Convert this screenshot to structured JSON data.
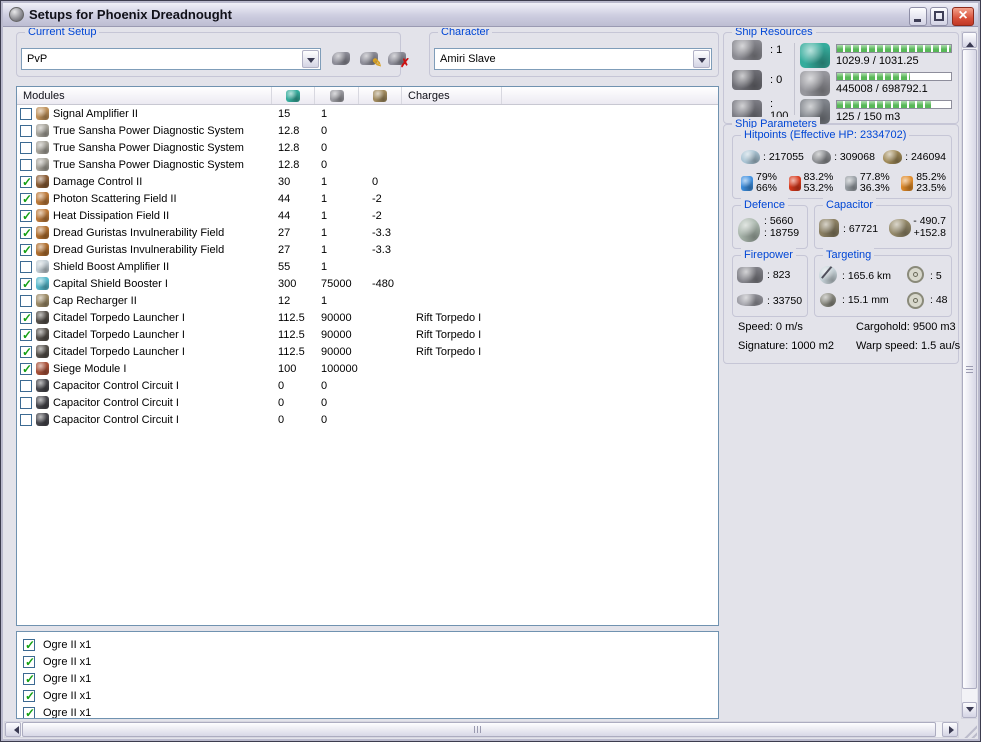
{
  "window": {
    "title": "Setups for Phoenix Dreadnought"
  },
  "setup_group": {
    "label": "Current Setup",
    "value": "PvP"
  },
  "character_group": {
    "label": "Character",
    "value": "Amiri Slave"
  },
  "modules_table": {
    "header": {
      "name": "Modules",
      "charges": "Charges"
    },
    "rows": [
      {
        "checked": false,
        "icon": "signal-amplifier",
        "color": "#bf915a",
        "name": "Signal Amplifier II",
        "cpu": "15",
        "pg": "1",
        "cap": "",
        "charge": ""
      },
      {
        "checked": false,
        "icon": "power-diagnostic",
        "color": "#a6a39a",
        "name": "True Sansha Power Diagnostic System",
        "cpu": "12.8",
        "pg": "0",
        "cap": "",
        "charge": ""
      },
      {
        "checked": false,
        "icon": "power-diagnostic",
        "color": "#a6a39a",
        "name": "True Sansha Power Diagnostic System",
        "cpu": "12.8",
        "pg": "0",
        "cap": "",
        "charge": ""
      },
      {
        "checked": false,
        "icon": "power-diagnostic",
        "color": "#a6a39a",
        "name": "True Sansha Power Diagnostic System",
        "cpu": "12.8",
        "pg": "0",
        "cap": "",
        "charge": ""
      },
      {
        "checked": true,
        "icon": "damage-control",
        "color": "#8a5c34",
        "name": "Damage Control II",
        "cpu": "30",
        "pg": "1",
        "cap": "0",
        "charge": ""
      },
      {
        "checked": true,
        "icon": "shield-hardener",
        "color": "#bd7a3a",
        "name": "Photon Scattering Field II",
        "cpu": "44",
        "pg": "1",
        "cap": "-2",
        "charge": ""
      },
      {
        "checked": true,
        "icon": "shield-hardener",
        "color": "#bd7a3a",
        "name": "Heat Dissipation Field II",
        "cpu": "44",
        "pg": "1",
        "cap": "-2",
        "charge": ""
      },
      {
        "checked": true,
        "icon": "shield-hardener",
        "color": "#b06f2f",
        "name": "Dread Guristas Invulnerability Field",
        "cpu": "27",
        "pg": "1",
        "cap": "-3.3",
        "charge": ""
      },
      {
        "checked": true,
        "icon": "shield-hardener",
        "color": "#b06f2f",
        "name": "Dread Guristas Invulnerability Field",
        "cpu": "27",
        "pg": "1",
        "cap": "-3.3",
        "charge": ""
      },
      {
        "checked": false,
        "icon": "shield-boost-amplifier",
        "color": "#c2cdd4",
        "name": "Shield Boost Amplifier II",
        "cpu": "55",
        "pg": "1",
        "cap": "",
        "charge": ""
      },
      {
        "checked": true,
        "icon": "shield-booster",
        "color": "#56b9cc",
        "name": "Capital Shield Booster I",
        "cpu": "300",
        "pg": "75000",
        "cap": "-480",
        "charge": ""
      },
      {
        "checked": false,
        "icon": "cap-recharger",
        "color": "#9c8a66",
        "name": "Cap Recharger II",
        "cpu": "12",
        "pg": "1",
        "cap": "",
        "charge": ""
      },
      {
        "checked": true,
        "icon": "torpedo-launcher",
        "color": "#55504a",
        "name": "Citadel Torpedo Launcher I",
        "cpu": "112.5",
        "pg": "90000",
        "cap": "",
        "charge": "Rift Torpedo I"
      },
      {
        "checked": true,
        "icon": "torpedo-launcher",
        "color": "#55504a",
        "name": "Citadel Torpedo Launcher I",
        "cpu": "112.5",
        "pg": "90000",
        "cap": "",
        "charge": "Rift Torpedo I"
      },
      {
        "checked": true,
        "icon": "torpedo-launcher",
        "color": "#55504a",
        "name": "Citadel Torpedo Launcher I",
        "cpu": "112.5",
        "pg": "90000",
        "cap": "",
        "charge": "Rift Torpedo I"
      },
      {
        "checked": true,
        "icon": "siege-module",
        "color": "#a85038",
        "name": "Siege Module I",
        "cpu": "100",
        "pg": "100000",
        "cap": "",
        "charge": ""
      },
      {
        "checked": false,
        "icon": "cap-control-circuit",
        "color": "#46464c",
        "name": "Capacitor Control Circuit I",
        "cpu": "0",
        "pg": "0",
        "cap": "",
        "charge": ""
      },
      {
        "checked": false,
        "icon": "cap-control-circuit",
        "color": "#46464c",
        "name": "Capacitor Control Circuit I",
        "cpu": "0",
        "pg": "0",
        "cap": "",
        "charge": ""
      },
      {
        "checked": false,
        "icon": "cap-control-circuit",
        "color": "#46464c",
        "name": "Capacitor Control Circuit I",
        "cpu": "0",
        "pg": "0",
        "cap": "",
        "charge": ""
      }
    ]
  },
  "drones_list": {
    "rows": [
      {
        "checked": true,
        "label": "Ogre II x1"
      },
      {
        "checked": true,
        "label": "Ogre II x1"
      },
      {
        "checked": true,
        "label": "Ogre II x1"
      },
      {
        "checked": true,
        "label": "Ogre II x1"
      },
      {
        "checked": true,
        "label": "Ogre II x1"
      }
    ]
  },
  "ship_resources": {
    "label": "Ship Resources",
    "slots": [
      {
        "icon": "turret-hardpoint",
        "color": "#8b8b92",
        "value": ": 1"
      },
      {
        "icon": "launcher-hardpoint",
        "color": "#6f6f76",
        "value": ": 0"
      },
      {
        "icon": "calibration",
        "color": "#7d7d85",
        "value": ": 100"
      }
    ],
    "bars": [
      {
        "icon": "cpu-chip",
        "color": "#35ac9c",
        "text": "1029.9 / 1031.25",
        "pct": 99.9
      },
      {
        "icon": "powergrid",
        "color": "#96969c",
        "text": "445008 / 698792.1",
        "pct": 63.7
      },
      {
        "icon": "dronebay",
        "color": "#7f838a",
        "text": "125 / 150 m3",
        "pct": 83.3
      }
    ]
  },
  "ship_parameters": {
    "label": "Ship Parameters",
    "hitpoints": {
      "label": "Hitpoints (Effective HP: 2334702)",
      "hp": [
        {
          "icon": "shield-hp",
          "color": "#a9c4d4",
          "value": ": 217055"
        },
        {
          "icon": "armor-hp",
          "color": "#8e9094",
          "value": ": 309068"
        },
        {
          "icon": "structure-hp",
          "color": "#a08a58",
          "value": ": 246094"
        }
      ],
      "resists": [
        {
          "icon": "em-resist",
          "color": "#3d8fe0",
          "top": "79%",
          "bottom": "66%"
        },
        {
          "icon": "thermal-resist",
          "color": "#d8391c",
          "top": "83.2%",
          "bottom": "53.2%"
        },
        {
          "icon": "kinetic-resist",
          "color": "#9aa0a6",
          "top": "77.8%",
          "bottom": "36.3%"
        },
        {
          "icon": "explosive-resist",
          "color": "#e08a28",
          "top": "85.2%",
          "bottom": "23.5%"
        }
      ]
    },
    "defence": {
      "label": "Defence",
      "value_top": ": 5660",
      "value_bottom": ": 18759"
    },
    "capacitor": {
      "label": "Capacitor",
      "amount": ": 67721",
      "delta_top": "- 490.7",
      "delta_bottom": "+152.8"
    },
    "firepower": {
      "label": "Firepower",
      "turret": ": 823",
      "missile": ": 33750"
    },
    "targeting": {
      "label": "Targeting",
      "range": ": 165.6 km",
      "max_targets": ": 5",
      "sig_res": ": 15.1 mm",
      "scan_res": ": 48"
    },
    "stats": {
      "speed": "Speed: 0 m/s",
      "signature": "Signature: 1000 m2",
      "cargohold": "Cargohold: 9500 m3",
      "warp": "Warp speed: 1.5 au/s"
    }
  }
}
